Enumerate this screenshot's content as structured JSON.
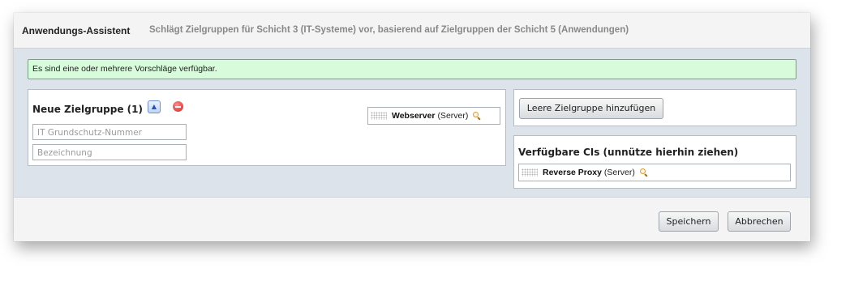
{
  "header": {
    "title": "Anwendungs-Assistent",
    "subtitle": "Schlägt Zielgruppen für Schicht 3 (IT-Systeme) vor, basierend auf Zielgruppen der Schicht 5 (Anwendungen)"
  },
  "notice": {
    "text": "Es sind eine oder mehrere Vorschläge verfügbar."
  },
  "new_group": {
    "title": "Neue Zielgruppe (1)",
    "collapse_icon": "double-chevron-up-icon",
    "remove_icon": "minus-circle-icon",
    "fields": {
      "number_placeholder": "IT Grundschutz-Nummer",
      "name_placeholder": "Bezeichnung"
    },
    "ci": {
      "name": "Webserver",
      "type": "(Server)",
      "icon": "magnifier-icon"
    }
  },
  "add_panel": {
    "button_label": "Leere Zielgruppe hinzufügen"
  },
  "available": {
    "title": "Verfügbare CIs (unnütze hierhin ziehen)",
    "items": [
      {
        "name": "Reverse Proxy",
        "type": "(Server)",
        "icon": "magnifier-icon"
      }
    ]
  },
  "footer": {
    "save_label": "Speichern",
    "cancel_label": "Abbrechen"
  },
  "colors": {
    "dialog_body": "#dde3ea",
    "header_bg": "#f4f4f4",
    "notice_bg": "#d8fbdc",
    "notice_border": "#6fa77b",
    "subtitle_text": "#888888"
  }
}
